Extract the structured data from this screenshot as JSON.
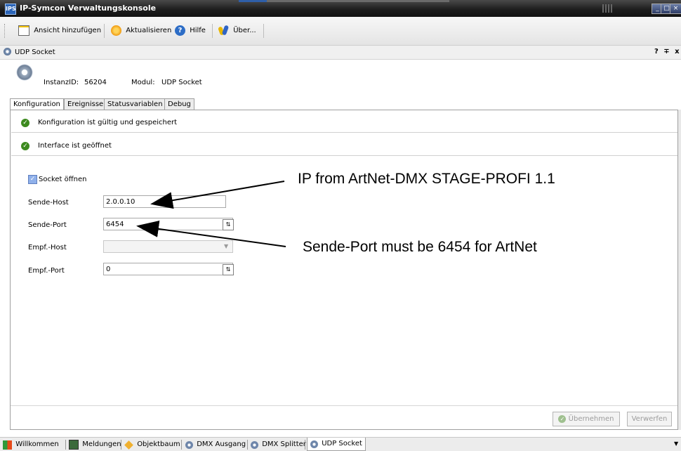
{
  "window": {
    "title": "IP-Symcon Verwaltungskonsole",
    "app_icon_text": "IPS"
  },
  "toolbar": {
    "add_view": "Ansicht hinzufügen",
    "refresh": "Aktualisieren",
    "help": "Hilfe",
    "about": "Über..."
  },
  "panel_header": {
    "title": "UDP Socket",
    "controls": "? ∓ x"
  },
  "instance": {
    "id_label": "InstanzID:",
    "id_value": "56204",
    "module_label": "Modul:",
    "module_value": "UDP Socket"
  },
  "tabs": [
    "Konfiguration",
    "Ereignisse",
    "Statusvariablen",
    "Debug"
  ],
  "status": {
    "config_ok": "Konfiguration ist gültig und gespeichert",
    "interface_open": "Interface ist geöffnet"
  },
  "form": {
    "socket_open_label": "Socket öffnen",
    "socket_open_checked": true,
    "send_host_label": "Sende-Host",
    "send_host_value": "2.0.0.10",
    "send_port_label": "Sende-Port",
    "send_port_value": "6454",
    "recv_host_label": "Empf.-Host",
    "recv_host_value": "",
    "recv_port_label": "Empf.-Port",
    "recv_port_value": "0"
  },
  "annotations": {
    "ip_note": "IP from ArtNet-DMX STAGE-PROFI 1.1",
    "port_note": "Sende-Port must be 6454 for ArtNet"
  },
  "buttons": {
    "apply": "Übernehmen",
    "discard": "Verwerfen"
  },
  "bottom_tabs": [
    "Willkommen",
    "Meldungen",
    "Objektbaum",
    "DMX Ausgang",
    "DMX Splitter",
    "UDP Socket"
  ],
  "colors": {
    "titlebar": "#1e1e1e",
    "ok_green": "#3d8a1f",
    "checkbox_blue": "#6b8fd6"
  }
}
